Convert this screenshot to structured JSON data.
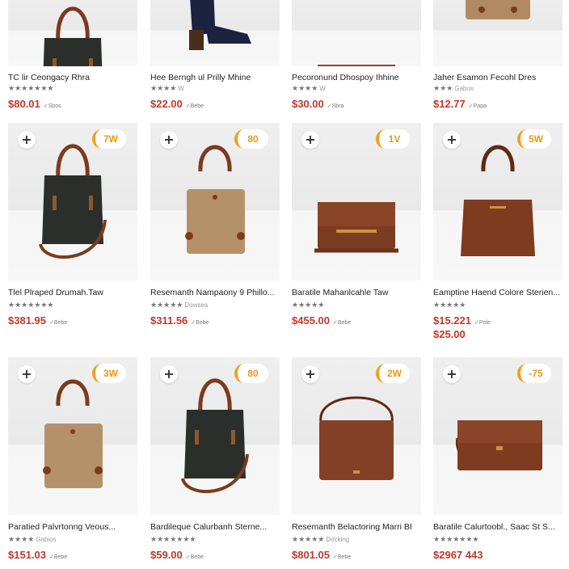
{
  "products": [
    {
      "title": "TC lir Ceongacy Rhra",
      "stars": "★★★★★★★",
      "rating": "",
      "price": "$80.01",
      "sub": "✓Sbos",
      "price2": "",
      "badge": "",
      "bag": "black-tote"
    },
    {
      "title": "Hee Berngh ul Prilly Mhine",
      "stars": "★★★★",
      "rating": "W",
      "price": "$22.00",
      "sub": "✓Bebe",
      "price2": "",
      "badge": "",
      "bag": "navy-boot"
    },
    {
      "title": "Pecoronund Dhospoy Ihhine",
      "stars": "★★★★",
      "rating": "W",
      "price": "$30.00",
      "sub": "✓Sbra",
      "price2": "",
      "badge": "",
      "bag": "brown-flat"
    },
    {
      "title": "Jaher Esamon Fecohl Dres",
      "stars": "★★★",
      "rating": "Gabos",
      "price": "$12.77",
      "sub": "✓Papa",
      "price2": "",
      "badge": "",
      "bag": "tan-top"
    },
    {
      "title": "Tlel Plraped Drumah.Taw",
      "stars": "★★★★★★★",
      "rating": "",
      "price": "$381.95",
      "sub": "✓Bebe",
      "price2": "",
      "badge": "7W",
      "bag": "black-tote"
    },
    {
      "title": "Resemanth Nampaony 9 Phillo...",
      "stars": "★★★★★",
      "rating": "Dowsea",
      "price": "$311.56",
      "sub": "✓Bebe",
      "price2": "",
      "badge": "80",
      "bag": "tan-square"
    },
    {
      "title": "Baratile Mahanlcahle Taw",
      "stars": "★★★★★",
      "rating": "",
      "price": "$455.00",
      "sub": "✓Bebe",
      "price2": "",
      "badge": "1V",
      "bag": "brown-flat"
    },
    {
      "title": "Eamptine Haend Colore Sterien...",
      "stars": "★★★★★",
      "rating": "",
      "price": "$15.221",
      "sub": "✓Pole",
      "price2": "$25.00",
      "badge": "5W",
      "bag": "brown-tote"
    },
    {
      "title": "Paratied Palvrtonng Veous...",
      "stars": "★★★★",
      "rating": "Gabios",
      "price": "$151.03",
      "sub": "✓Bebe",
      "price2": "",
      "badge": "3W",
      "bag": "tan-square"
    },
    {
      "title": "Bardileque Calurbanh Sterne...",
      "stars": "★★★★★★★",
      "rating": "",
      "price": "$59.00",
      "sub": "✓Bebe",
      "price2": "",
      "badge": "80",
      "bag": "black-tote"
    },
    {
      "title": "Resemanth Belactoring Marri BI",
      "stars": "★★★★★",
      "rating": "Docking",
      "price": "$801.05",
      "sub": "✓Bebe",
      "price2": "",
      "badge": "2W",
      "bag": "brown-cross"
    },
    {
      "title": "Baratile Calurtoobl., Saac St S...",
      "stars": "★★★★★★★",
      "rating": "",
      "price": "$2967 443",
      "sub": "",
      "price2": "",
      "badge": "-75",
      "bag": "brown-clutch"
    }
  ]
}
